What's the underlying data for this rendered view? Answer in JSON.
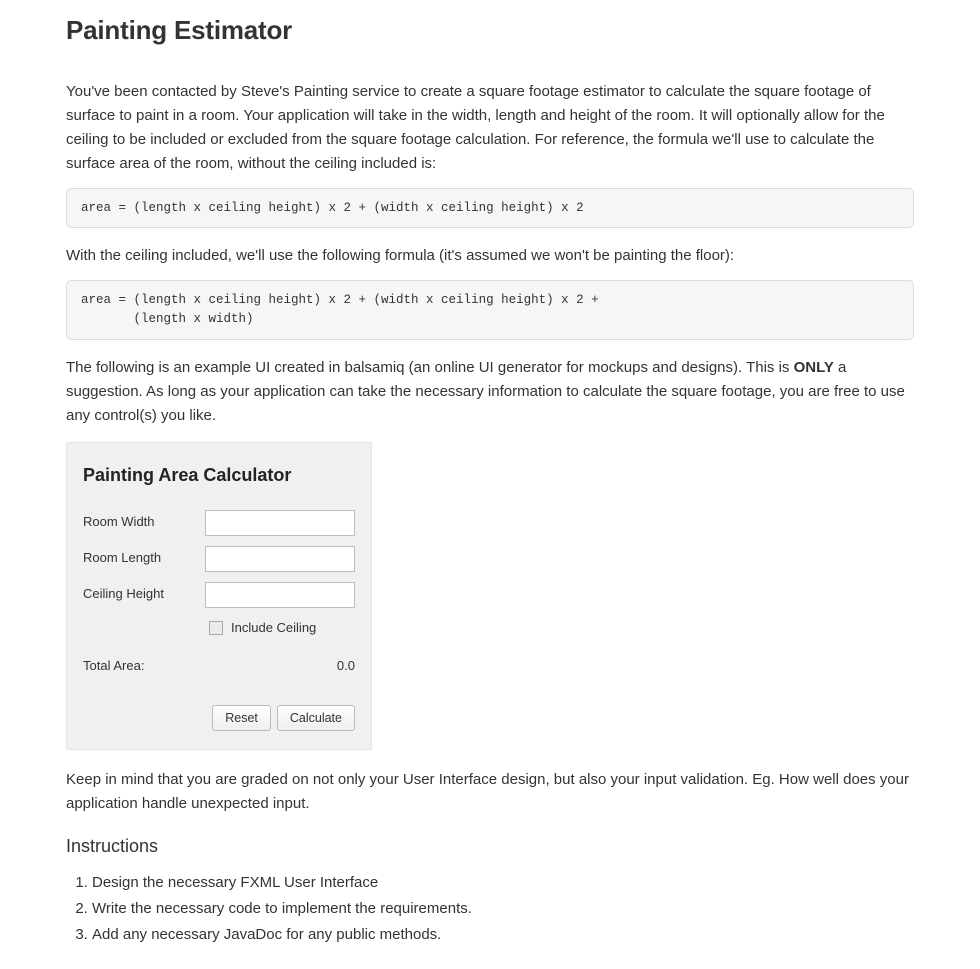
{
  "page": {
    "title": "Painting Estimator",
    "intro": "You've been contacted by Steve's Painting service to create a square footage estimator to calculate the square footage of surface to paint in a room. Your application will take in the width, length and height of the room. It will optionally allow for the ceiling to be included or excluded from the square footage calculation. For reference, the formula we'll use to calculate the surface area of the room, without the ceiling included is:",
    "formula1": "area = (length x ceiling height) x 2 + (width x ceiling height) x 2",
    "with_ceiling_text": "With the ceiling included, we'll use the following formula (it's assumed we won't be painting the floor):",
    "formula2": "area = (length x ceiling height) x 2 + (width x ceiling height) x 2 +\n       (length x width)",
    "mockup_intro_prefix": "The following is an example UI created in balsamiq (an online UI generator for mockups and designs). This is ",
    "mockup_intro_bold": "ONLY",
    "mockup_intro_suffix": " a suggestion. As long as your application can take the necessary information to calculate the square footage, you are free to use any control(s) you like.",
    "grading_note": "Keep in mind that you are graded on not only your User Interface design, but also your input validation. Eg. How well does your application handle unexpected input.",
    "instructions_heading": "Instructions",
    "instructions": [
      "Design the necessary FXML User Interface",
      "Write the necessary code to implement the requirements.",
      "Add any necessary JavaDoc for any public methods."
    ]
  },
  "calculator": {
    "title": "Painting Area Calculator",
    "labels": {
      "width": "Room Width",
      "length": "Room Length",
      "height": "Ceiling Height",
      "include_ceiling": "Include Ceiling",
      "total": "Total Area:"
    },
    "values": {
      "width": "",
      "length": "",
      "height": "",
      "total": "0.0"
    },
    "buttons": {
      "reset": "Reset",
      "calculate": "Calculate"
    }
  }
}
